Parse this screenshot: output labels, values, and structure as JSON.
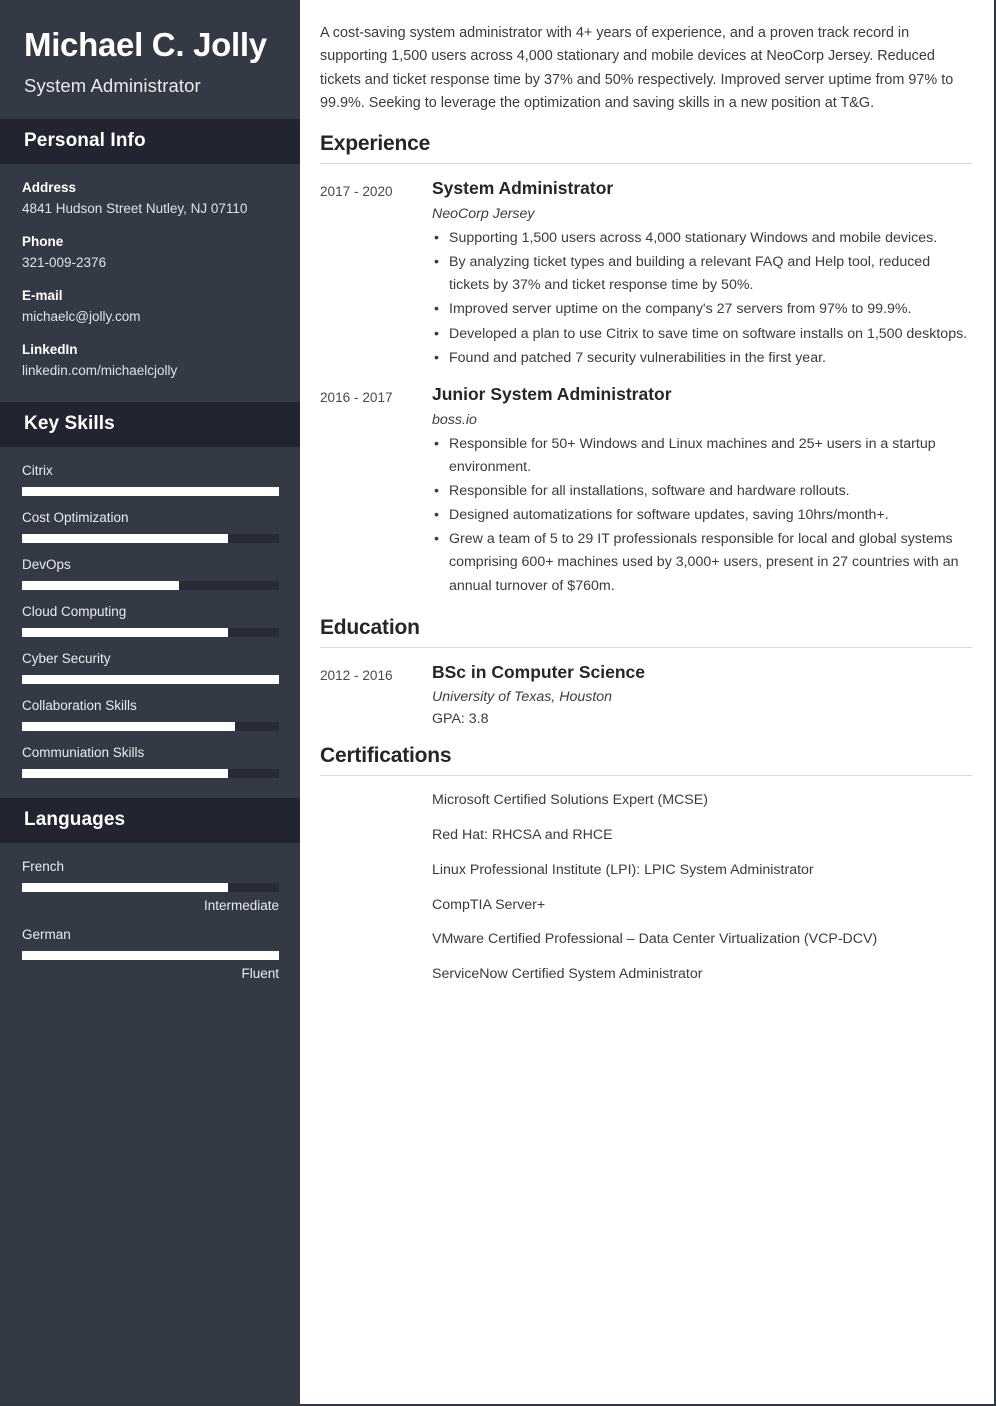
{
  "sidebar": {
    "full_name": "Michael C. Jolly",
    "job_title": "System Administrator",
    "personal_info": {
      "heading": "Personal Info",
      "fields": [
        {
          "label": "Address",
          "value": "4841 Hudson Street\nNutley, NJ 07110"
        },
        {
          "label": "Phone",
          "value": "321-009-2376"
        },
        {
          "label": "E-mail",
          "value": "michaelc@jolly.com"
        },
        {
          "label": "LinkedIn",
          "value": "linkedin.com/michaelcjolly"
        }
      ]
    },
    "key_skills": {
      "heading": "Key Skills",
      "items": [
        {
          "label": "Citrix",
          "level": 100
        },
        {
          "label": "Cost Optimization",
          "level": 80
        },
        {
          "label": "DevOps",
          "level": 61
        },
        {
          "label": "Cloud Computing",
          "level": 80
        },
        {
          "label": "Cyber Security",
          "level": 100
        },
        {
          "label": "Collaboration Skills",
          "level": 83
        },
        {
          "label": "Communiation Skills",
          "level": 80
        }
      ]
    },
    "languages": {
      "heading": "Languages",
      "items": [
        {
          "label": "French",
          "level": 80,
          "value": "Intermediate"
        },
        {
          "label": "German",
          "level": 100,
          "value": "Fluent"
        }
      ]
    }
  },
  "main": {
    "summary": "A cost-saving system administrator with 4+ years of experience, and a proven track record in supporting 1,500 users across 4,000 stationary and mobile devices at NeoCorp Jersey. Reduced tickets and ticket response time by 37% and 50% respectively. Improved server uptime from 97% to 99.9%. Seeking to leverage the optimization and saving skills in a new position at T&G.",
    "experience": {
      "heading": "Experience",
      "entries": [
        {
          "dates": "2017 - 2020",
          "role": "System Administrator",
          "org": "NeoCorp Jersey",
          "bullets": [
            "Supporting 1,500 users across 4,000 stationary Windows and mobile devices.",
            "By analyzing ticket types and building a relevant FAQ and Help tool, reduced tickets by 37% and ticket response time by 50%.",
            "Improved server uptime on the company's 27 servers from 97% to 99.9%.",
            "Developed a plan to use Citrix to save time on software installs on 1,500 desktops.",
            "Found and patched 7 security vulnerabilities in the first year."
          ]
        },
        {
          "dates": "2016 - 2017",
          "role": "Junior System Administrator",
          "org": "boss.io",
          "bullets": [
            "Responsible for 50+ Windows and Linux machines and 25+ users in a startup environment.",
            "Responsible for all installations, software and hardware rollouts.",
            "Designed automatizations for software updates, saving 10hrs/month+.",
            "Grew a team of 5 to 29 IT professionals responsible for local and global systems comprising 600+ machines used by 3,000+ users, present in 27 countries with an annual turnover of $760m."
          ]
        }
      ]
    },
    "education": {
      "heading": "Education",
      "entries": [
        {
          "dates": "2012 - 2016",
          "degree": "BSc in Computer Science",
          "school": "University of Texas, Houston",
          "gpa": "GPA: 3.8"
        }
      ]
    },
    "certifications": {
      "heading": "Certifications",
      "items": [
        "Microsoft Certified Solutions Expert (MCSE)",
        "Red Hat: RHCSA and RHCE",
        "Linux Professional Institute (LPI): LPIC System Administrator",
        "CompTIA Server+",
        "VMware Certified Professional – Data Center Virtualization (VCP-DCV)",
        "ServiceNow Certified System Administrator"
      ]
    }
  }
}
